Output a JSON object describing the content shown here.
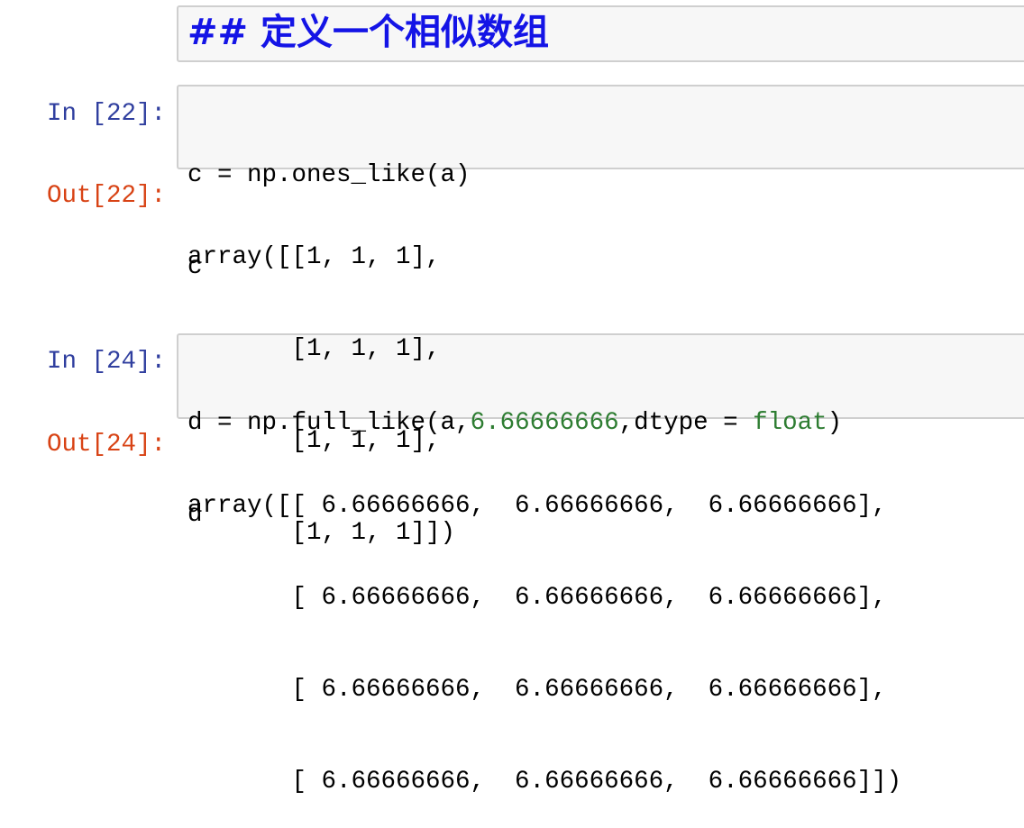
{
  "cells": [
    {
      "type": "markdown",
      "text": "## 定义一个相似数组"
    },
    {
      "type": "code",
      "prompt": "In [22]:",
      "lines": [
        "c = np.ones_like(a)",
        "c"
      ]
    },
    {
      "type": "output",
      "prompt": "Out[22]:",
      "lines": [
        "array([[1, 1, 1],",
        "       [1, 1, 1],",
        "       [1, 1, 1],",
        "       [1, 1, 1]])"
      ]
    },
    {
      "type": "code",
      "prompt": "In [24]:",
      "line1": {
        "pre": "d = np.full_like(a,",
        "num": "6.66666666",
        "mid": ",dtype = ",
        "builtin": "float",
        "post": ")"
      },
      "lines": [
        "d"
      ]
    },
    {
      "type": "output",
      "prompt": "Out[24]:",
      "lines": [
        "array([[ 6.66666666,  6.66666666,  6.66666666],",
        "       [ 6.66666666,  6.66666666,  6.66666666],",
        "       [ 6.66666666,  6.66666666,  6.66666666],",
        "       [ 6.66666666,  6.66666666,  6.66666666]])"
      ]
    }
  ],
  "colors": {
    "in_prompt": "#303f9f",
    "out_prompt": "#d84315",
    "heading": "#1414e6",
    "number": "#2e7d32"
  }
}
